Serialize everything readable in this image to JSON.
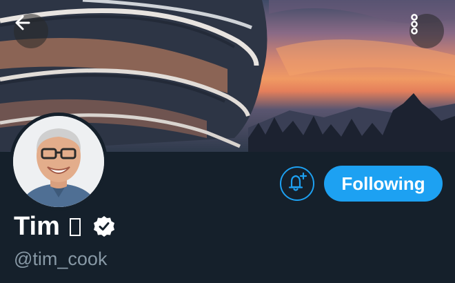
{
  "header": {
    "back_icon": "arrow-left-icon",
    "more_icon": "more-vertical-icon",
    "banner_subject": "Apple Park ring building at sunset"
  },
  "profile": {
    "display_name": "Tim",
    "name_emoji_glyph": "missing-glyph-box",
    "verified_icon": "verified-badge-icon",
    "handle": "@tim_cook"
  },
  "actions": {
    "notify_icon": "bell-plus-icon",
    "follow_label": "Following"
  },
  "colors": {
    "background": "#15202b",
    "accent": "#1da1f2",
    "secondary_text": "#8899a6",
    "primary_text": "#ffffff"
  }
}
